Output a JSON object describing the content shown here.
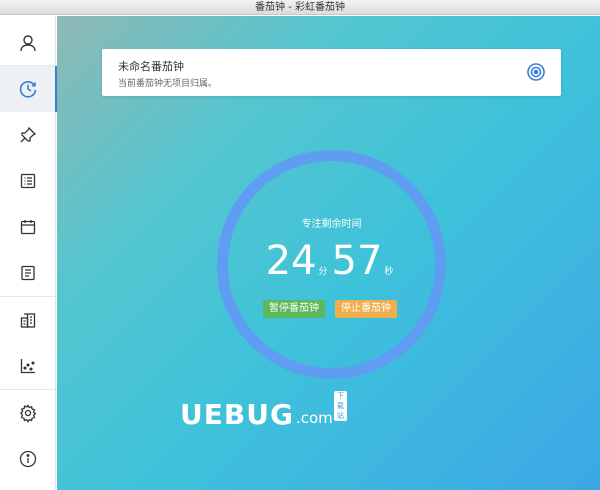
{
  "window": {
    "title": "番茄钟 - 彩虹番茄钟"
  },
  "sidebar": {
    "items": [
      {
        "name": "nav-user",
        "icon": "user-icon",
        "active": false
      },
      {
        "name": "nav-clock",
        "icon": "clock-icon",
        "active": true
      },
      {
        "name": "nav-pin",
        "icon": "pin-icon",
        "active": false
      },
      {
        "name": "nav-list",
        "icon": "list-icon",
        "active": false
      },
      {
        "name": "nav-calendar",
        "icon": "calendar-icon",
        "active": false
      },
      {
        "name": "nav-report",
        "icon": "report-icon",
        "active": false
      },
      {
        "name": "nav-stats-building",
        "icon": "building-icon",
        "active": false
      },
      {
        "name": "nav-scatter",
        "icon": "scatter-chart-icon",
        "active": false
      },
      {
        "name": "nav-settings",
        "icon": "gear-icon",
        "active": false
      },
      {
        "name": "nav-info",
        "icon": "info-icon",
        "active": false
      }
    ]
  },
  "task": {
    "title": "未命名番茄钟",
    "subtitle": "当前番茄钟无项目归属。",
    "action_icon": "target-icon"
  },
  "timer": {
    "label": "专注剩余时间",
    "minutes": "24",
    "minutes_unit": "分",
    "seconds": "57",
    "seconds_unit": "秒",
    "ring_color": "#5f9df3"
  },
  "actions": {
    "pause_label": "暂停番茄钟",
    "stop_label": "停止番茄钟",
    "pause_color": "#5cb85c",
    "stop_color": "#f0ad4e"
  },
  "watermark": {
    "text": "UEBUG",
    "suffix": ".com",
    "badge": "下载站"
  }
}
